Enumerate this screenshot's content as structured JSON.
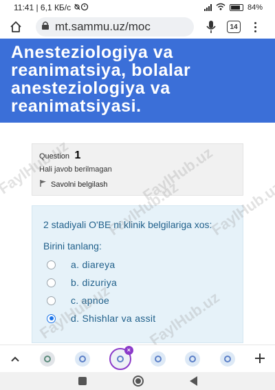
{
  "status_bar": {
    "time_info": "11:41 | 6,1 КБ/с",
    "battery": "84",
    "battery_level": 0.84
  },
  "browser": {
    "url": "mt.sammu.uz/moc",
    "tab_count": "14"
  },
  "page": {
    "title": "Anesteziologiya va reanimatsiya, bolalar anesteziologiya va reanimatsiyasi."
  },
  "question_info": {
    "label": "Question",
    "number": "1",
    "state": "Hali javob berilmagan",
    "flag_label": "Savolni belgilash"
  },
  "question": {
    "text": "2 stadiyali O'BE ni klinik belgilariga xos:",
    "prompt": "Birini tanlang:",
    "answers": [
      {
        "label": "a. diareya",
        "checked": false
      },
      {
        "label": "b. dizuriya",
        "checked": false
      },
      {
        "label": "c. apnoe",
        "checked": false
      },
      {
        "label": "d. Shishlar va assit",
        "checked": true
      }
    ]
  },
  "watermark": "FaylHub.uz",
  "colors": {
    "header_blue": "#3b6fd8",
    "question_bg": "#e6f2f9",
    "question_text": "#1f5f8a",
    "info_bg": "#f1f1f1",
    "active_tab": "#8b3ac9"
  }
}
